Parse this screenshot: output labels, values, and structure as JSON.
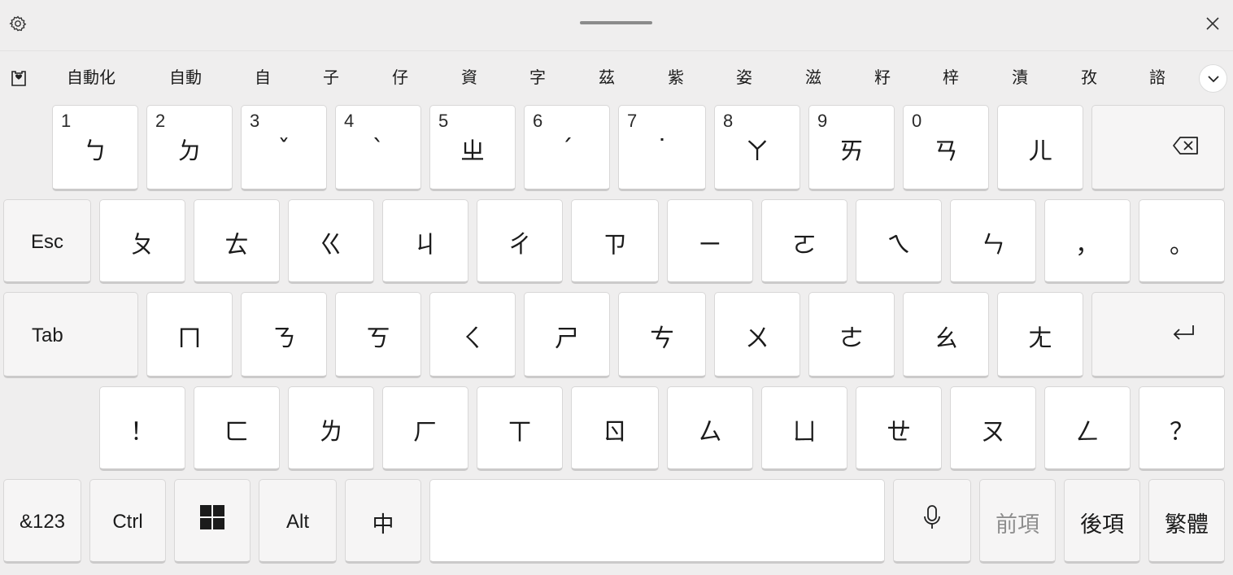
{
  "candidates": [
    "自動化",
    "自動",
    "自",
    "子",
    "仔",
    "資",
    "字",
    "茲",
    "紫",
    "姿",
    "滋",
    "籽",
    "梓",
    "漬",
    "孜",
    "諮"
  ],
  "rows": {
    "numbers": [
      {
        "num": "1",
        "main": "ㄅ"
      },
      {
        "num": "2",
        "main": "ㄉ"
      },
      {
        "num": "3",
        "main": "ˇ"
      },
      {
        "num": "4",
        "main": "ˋ"
      },
      {
        "num": "5",
        "main": "ㄓ"
      },
      {
        "num": "6",
        "main": "ˊ"
      },
      {
        "num": "7",
        "main": "˙"
      },
      {
        "num": "8",
        "main": "ㄚ"
      },
      {
        "num": "9",
        "main": "ㄞ"
      },
      {
        "num": "0",
        "main": "ㄢ"
      },
      {
        "num": "",
        "main": "ㄦ"
      }
    ],
    "row2": [
      "Esc",
      "ㄆ",
      "ㄊ",
      "ㄍ",
      "ㄐ",
      "ㄔ",
      "ㄗ",
      "ㄧ",
      "ㄛ",
      "ㄟ",
      "ㄣ",
      "，",
      "。"
    ],
    "row3": [
      "Tab",
      "ㄇ",
      "ㄋ",
      "ㄎ",
      "ㄑ",
      "ㄕ",
      "ㄘ",
      "ㄨ",
      "ㄜ",
      "ㄠ",
      "ㄤ"
    ],
    "row4": [
      "！",
      "ㄈ",
      "ㄌ",
      "ㄏ",
      "ㄒ",
      "ㄖ",
      "ㄙ",
      "ㄩ",
      "ㄝ",
      "ㄡ",
      "ㄥ",
      "？"
    ],
    "bottom": {
      "symbols": "&123",
      "ctrl": "Ctrl",
      "alt": "Alt",
      "ime": "中",
      "prev": "前項",
      "next": "後項",
      "trad": "繁體"
    }
  },
  "icons": {
    "settings": "gear-icon",
    "close": "close-icon",
    "favorites": "clipboard-heart-icon",
    "expand": "chevron-down-icon",
    "backspace": "backspace-icon",
    "enter": "enter-icon",
    "windows": "windows-logo-icon",
    "mic": "microphone-icon"
  },
  "colors": {
    "background": "#efeeee",
    "key": "#ffffff",
    "disabled_text": "#8e8e8e"
  }
}
